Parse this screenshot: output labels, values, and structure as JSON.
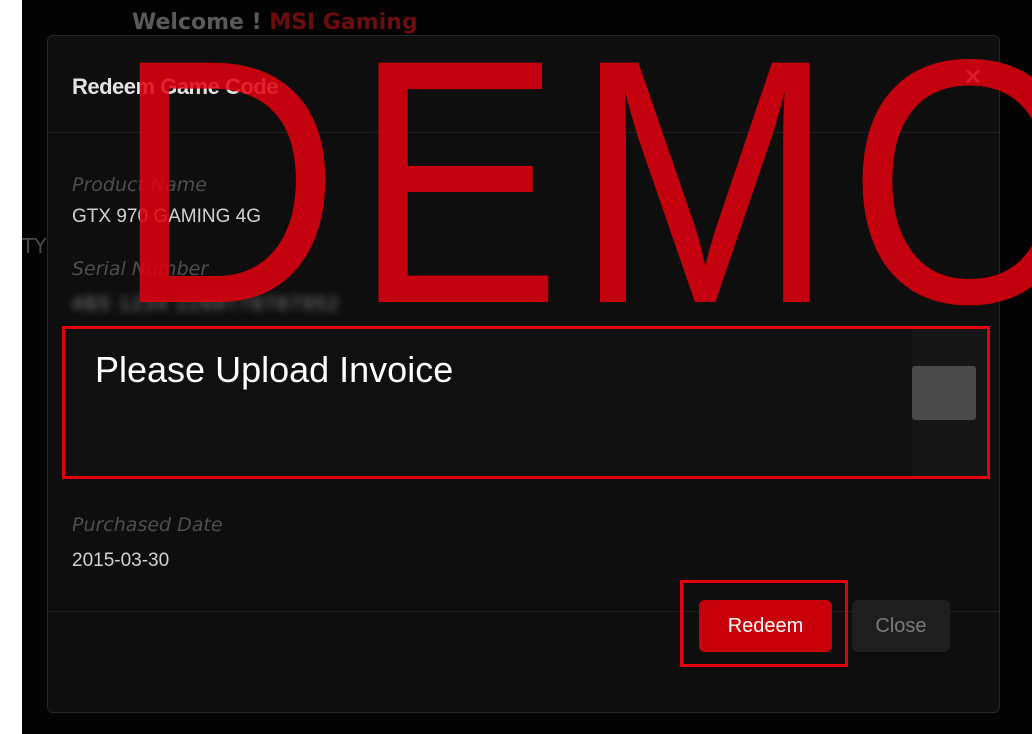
{
  "background": {
    "welcome_prefix": "Welcome ! ",
    "welcome_user": "MSI Gaming",
    "side_text": "TY"
  },
  "modal": {
    "title": "Redeem Game Code",
    "close_glyph": "×",
    "fields": {
      "product_name_label": "Product Name",
      "product_name_value": "GTX 970 GAMING 4G",
      "serial_number_label": "Serial Number",
      "serial_number_value": "4B5 1234 2268778787952",
      "purchased_date_label": "Purchased Date",
      "purchased_date_value": "2015-03-30"
    },
    "upload": {
      "label": "Please Upload Invoice"
    },
    "buttons": {
      "redeem": "Redeem",
      "close": "Close"
    }
  },
  "watermark": "DEMO",
  "colors": {
    "accent": "#c8000a",
    "highlight": "#e4000f",
    "background": "#030303"
  }
}
